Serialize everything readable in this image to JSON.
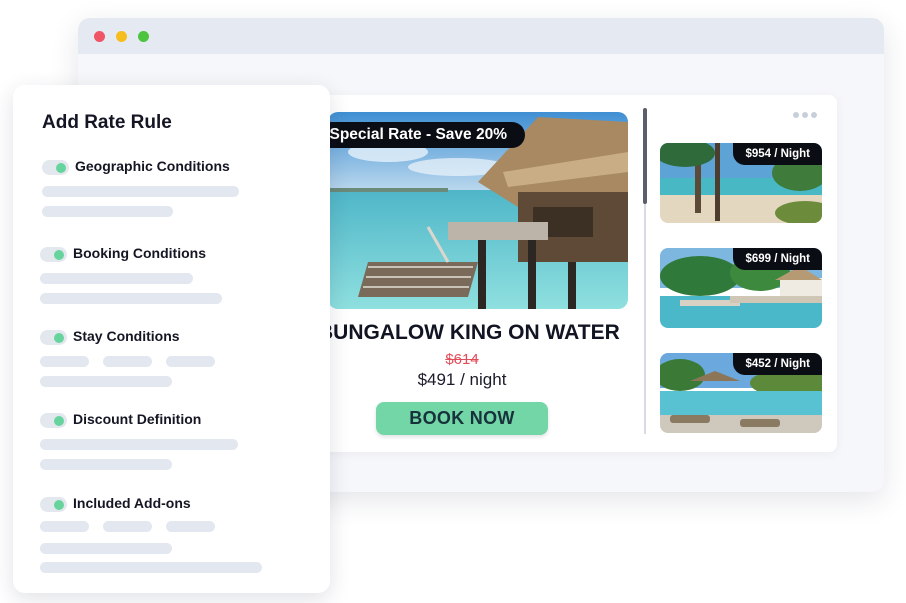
{
  "rule_panel": {
    "title": "Add Rate Rule",
    "conditions": [
      {
        "label": "Geographic Conditions",
        "enabled": true
      },
      {
        "label": "Booking Conditions",
        "enabled": true
      },
      {
        "label": "Stay Conditions",
        "enabled": true
      },
      {
        "label": "Discount Definition",
        "enabled": true
      },
      {
        "label": "Included Add-ons",
        "enabled": true
      }
    ]
  },
  "booking_card": {
    "banner": "Special Rate - Save 20%",
    "room_title": "BUNGALOW KING ON WATER",
    "old_price": "$614",
    "new_price": "$491 / night",
    "book_button": "BOOK NOW"
  },
  "thumbnails": [
    {
      "price": "$954 / Night"
    },
    {
      "price": "$699 / Night"
    },
    {
      "price": "$452 / Night"
    }
  ],
  "colors": {
    "accent_green": "#72d6a6",
    "strike_red": "#e34d5a",
    "dark_label": "#0b0d14"
  }
}
